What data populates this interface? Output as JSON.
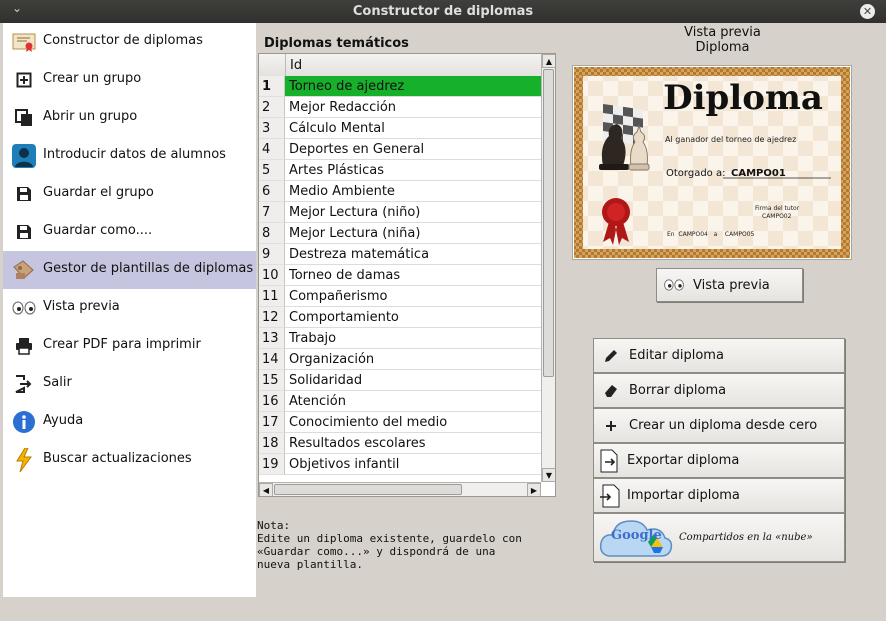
{
  "window": {
    "title": "Constructor de diplomas",
    "menu_glyph": "⌄",
    "close_glyph": "✕"
  },
  "sidebar": {
    "items": [
      {
        "label": "Constructor de diplomas",
        "icon": "certificate-icon"
      },
      {
        "label": "Crear un grupo",
        "icon": "add-box-icon"
      },
      {
        "label": "Abrir un grupo",
        "icon": "copy-icon"
      },
      {
        "label": "Introducir datos de alumnos",
        "icon": "user-icon"
      },
      {
        "label": "Guardar el grupo",
        "icon": "save-icon"
      },
      {
        "label": "Guardar como....",
        "icon": "save-as-icon"
      },
      {
        "label": "Gestor de plantillas de diplomas",
        "icon": "template-icon",
        "selected": true
      },
      {
        "label": "Vista previa",
        "icon": "eyes-icon"
      },
      {
        "label": "Crear PDF para imprimir",
        "icon": "printer-icon"
      },
      {
        "label": "Salir",
        "icon": "exit-icon"
      },
      {
        "label": "Ayuda",
        "icon": "info-icon"
      },
      {
        "label": "Buscar actualizaciones",
        "icon": "lightning-icon"
      }
    ]
  },
  "list": {
    "title": "Diplomas temáticos",
    "column": "Id",
    "rows": [
      {
        "n": "1",
        "name": "Torneo de ajedrez"
      },
      {
        "n": "2",
        "name": "Mejor Redacción"
      },
      {
        "n": "3",
        "name": "Cálculo Mental"
      },
      {
        "n": "4",
        "name": "Deportes en General"
      },
      {
        "n": "5",
        "name": "Artes Plásticas"
      },
      {
        "n": "6",
        "name": "Medio Ambiente"
      },
      {
        "n": "7",
        "name": "Mejor Lectura (niño)"
      },
      {
        "n": "8",
        "name": "Mejor Lectura (niña)"
      },
      {
        "n": "9",
        "name": "Destreza matemática"
      },
      {
        "n": "10",
        "name": "Torneo de damas"
      },
      {
        "n": "11",
        "name": "Compañerismo"
      },
      {
        "n": "12",
        "name": "Comportamiento"
      },
      {
        "n": "13",
        "name": "Trabajo"
      },
      {
        "n": "14",
        "name": "Organización"
      },
      {
        "n": "15",
        "name": "Solidaridad"
      },
      {
        "n": "16",
        "name": "Atención"
      },
      {
        "n": "17",
        "name": "Conocimiento del medio"
      },
      {
        "n": "18",
        "name": "Resultados escolares"
      },
      {
        "n": "19",
        "name": "Objetivos infantil"
      }
    ],
    "selected_index": 0,
    "scroll_up": "▲",
    "scroll_down": "▼",
    "scroll_left": "◀",
    "scroll_right": "▶"
  },
  "note": "Nota:\nEdite un diploma existente, guardelo con\n«Guardar como...» y dispondrá de una\nnueva plantilla.",
  "preview": {
    "title_line1": "Vista previa",
    "title_line2": "Diploma",
    "diploma": {
      "heading": "Diploma",
      "subtitle": "Al ganador del torneo de ajedrez",
      "awarded_label": "Otorgado a:",
      "awarded_value": "CAMPO01",
      "signature_label": "Firma del tutor",
      "signature_value": "CAMPO02",
      "place_line": "En  CAMPO04   a    CAMPO05"
    },
    "button": "Vista previa"
  },
  "actions": {
    "edit": "Editar diploma",
    "delete": "Borrar diploma",
    "create": "Crear un diploma desde cero",
    "export": "Exportar diploma",
    "import": "Importar diploma",
    "cloud_caption": "Compartidos en la «nube»",
    "cloud_logo": "Google"
  },
  "colors": {
    "selected_row": "#16b02b",
    "sidebar_selected": "#c6c5df",
    "window_bg": "#d6d2cb"
  }
}
